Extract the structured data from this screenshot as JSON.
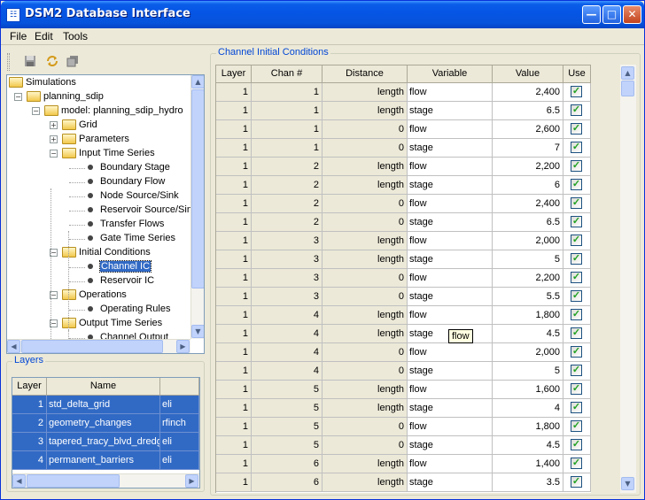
{
  "window": {
    "title": "DSM2 Database Interface"
  },
  "menu": [
    "File",
    "Edit",
    "Tools"
  ],
  "toolbar": [
    "save-icon",
    "refresh-icon",
    "copy-icon"
  ],
  "tree": {
    "items": [
      {
        "label": "Simulations",
        "type": "folder",
        "expander": ""
      },
      {
        "label": "planning_sdip",
        "type": "folder",
        "expander": "minus"
      },
      {
        "label": "model: planning_sdip_hydro",
        "type": "folder",
        "expander": "minus"
      },
      {
        "label": "Grid",
        "type": "folder",
        "expander": "plus"
      },
      {
        "label": "Parameters",
        "type": "folder",
        "expander": "plus"
      },
      {
        "label": "Input Time Series",
        "type": "folder",
        "expander": "minus"
      },
      {
        "label": "Boundary Stage",
        "type": "leaf"
      },
      {
        "label": "Boundary Flow",
        "type": "leaf"
      },
      {
        "label": "Node Source/Sink",
        "type": "leaf"
      },
      {
        "label": "Reservoir Source/Sink",
        "type": "leaf"
      },
      {
        "label": "Transfer Flows",
        "type": "leaf"
      },
      {
        "label": "Gate Time Series",
        "type": "leaf"
      },
      {
        "label": "Initial Conditions",
        "type": "folder",
        "expander": "minus"
      },
      {
        "label": "Channel IC",
        "type": "leaf",
        "selected": true
      },
      {
        "label": "Reservoir IC",
        "type": "leaf"
      },
      {
        "label": "Operations",
        "type": "folder",
        "expander": "minus"
      },
      {
        "label": "Operating Rules",
        "type": "leaf"
      },
      {
        "label": "Output Time Series",
        "type": "folder",
        "expander": "minus"
      },
      {
        "label": "Channel Output",
        "type": "leaf"
      }
    ]
  },
  "layers": {
    "title": "Layers",
    "columns": [
      "Layer",
      "Name",
      ""
    ],
    "rows": [
      {
        "layer": "1",
        "name": "std_delta_grid",
        "user": "eli"
      },
      {
        "layer": "2",
        "name": "geometry_changes",
        "user": "rfinch"
      },
      {
        "layer": "3",
        "name": "tapered_tracy_blvd_dredge",
        "user": "eli"
      },
      {
        "layer": "4",
        "name": "permanent_barriers",
        "user": "eli"
      }
    ]
  },
  "channel_ic": {
    "title": "Channel Initial Conditions",
    "columns": [
      "Layer",
      "Chan #",
      "Distance",
      "Variable",
      "Value",
      "Use"
    ],
    "rows": [
      {
        "layer": "1",
        "chan": "1",
        "distance": "length",
        "variable": "flow",
        "value": "2,400",
        "use": true
      },
      {
        "layer": "1",
        "chan": "1",
        "distance": "length",
        "variable": "stage",
        "value": "6.5",
        "use": true
      },
      {
        "layer": "1",
        "chan": "1",
        "distance": "0",
        "variable": "flow",
        "value": "2,600",
        "use": true
      },
      {
        "layer": "1",
        "chan": "1",
        "distance": "0",
        "variable": "stage",
        "value": "7",
        "use": true
      },
      {
        "layer": "1",
        "chan": "2",
        "distance": "length",
        "variable": "flow",
        "value": "2,200",
        "use": true
      },
      {
        "layer": "1",
        "chan": "2",
        "distance": "length",
        "variable": "stage",
        "value": "6",
        "use": true
      },
      {
        "layer": "1",
        "chan": "2",
        "distance": "0",
        "variable": "flow",
        "value": "2,400",
        "use": true
      },
      {
        "layer": "1",
        "chan": "2",
        "distance": "0",
        "variable": "stage",
        "value": "6.5",
        "use": true
      },
      {
        "layer": "1",
        "chan": "3",
        "distance": "length",
        "variable": "flow",
        "value": "2,000",
        "use": true
      },
      {
        "layer": "1",
        "chan": "3",
        "distance": "length",
        "variable": "stage",
        "value": "5",
        "use": true
      },
      {
        "layer": "1",
        "chan": "3",
        "distance": "0",
        "variable": "flow",
        "value": "2,200",
        "use": true
      },
      {
        "layer": "1",
        "chan": "3",
        "distance": "0",
        "variable": "stage",
        "value": "5.5",
        "use": true
      },
      {
        "layer": "1",
        "chan": "4",
        "distance": "length",
        "variable": "flow",
        "value": "1,800",
        "use": true
      },
      {
        "layer": "1",
        "chan": "4",
        "distance": "length",
        "variable": "stage",
        "value": "4.5",
        "use": true
      },
      {
        "layer": "1",
        "chan": "4",
        "distance": "0",
        "variable": "flow",
        "value": "2,000",
        "use": true
      },
      {
        "layer": "1",
        "chan": "4",
        "distance": "0",
        "variable": "stage",
        "value": "5",
        "use": true
      },
      {
        "layer": "1",
        "chan": "5",
        "distance": "length",
        "variable": "flow",
        "value": "1,600",
        "use": true
      },
      {
        "layer": "1",
        "chan": "5",
        "distance": "length",
        "variable": "stage",
        "value": "4",
        "use": true
      },
      {
        "layer": "1",
        "chan": "5",
        "distance": "0",
        "variable": "flow",
        "value": "1,800",
        "use": true
      },
      {
        "layer": "1",
        "chan": "5",
        "distance": "0",
        "variable": "stage",
        "value": "4.5",
        "use": true
      },
      {
        "layer": "1",
        "chan": "6",
        "distance": "length",
        "variable": "flow",
        "value": "1,400",
        "use": true
      },
      {
        "layer": "1",
        "chan": "6",
        "distance": "length",
        "variable": "stage",
        "value": "3.5",
        "use": true
      }
    ]
  },
  "tooltip": "flow"
}
